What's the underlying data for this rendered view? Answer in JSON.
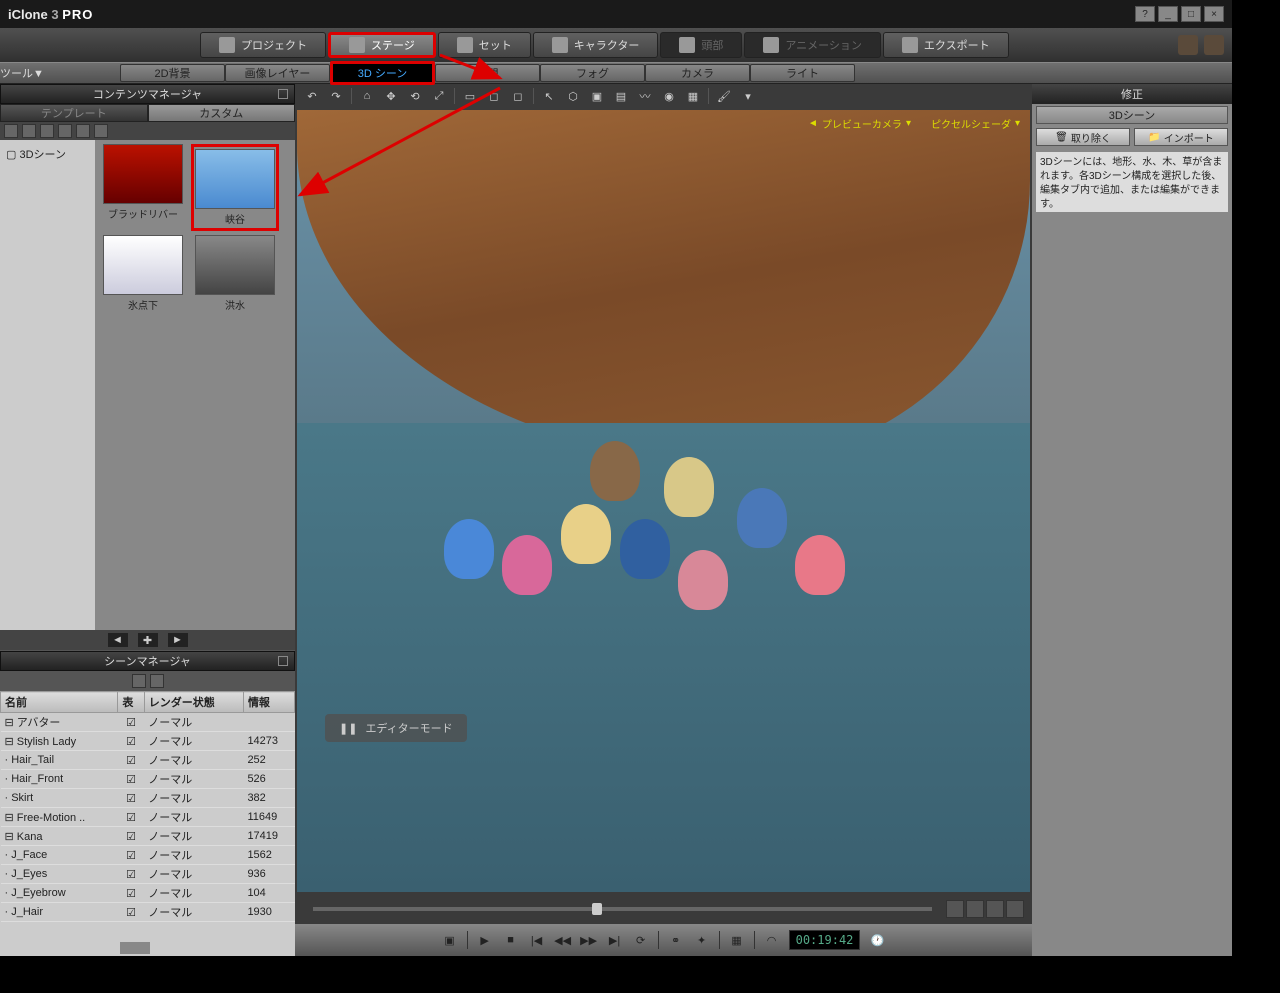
{
  "app": {
    "name": "iClone",
    "version": "3",
    "edition": "PRO"
  },
  "winButtons": [
    "?",
    "_",
    "□",
    "×"
  ],
  "mainTabs": [
    {
      "label": "プロジェクト"
    },
    {
      "label": "ステージ",
      "active": true,
      "highlighted": true
    },
    {
      "label": "セット"
    },
    {
      "label": "キャラクター"
    },
    {
      "label": "頭部",
      "dim": true
    },
    {
      "label": "アニメーション",
      "dim": true
    },
    {
      "label": "エクスポート"
    }
  ],
  "toolLabel": "ツール▼",
  "subTabs": [
    {
      "label": "2D背景"
    },
    {
      "label": "画像レイヤー"
    },
    {
      "label": "3D シーン",
      "active": true,
      "highlighted": true
    },
    {
      "label": "空間"
    },
    {
      "label": "フォグ"
    },
    {
      "label": "カメラ"
    },
    {
      "label": "ライト"
    }
  ],
  "contentManager": {
    "title": "コンテンツマネージャ",
    "tabs": [
      {
        "label": "テンプレート"
      },
      {
        "label": "カスタム",
        "active": true
      }
    ],
    "treeItem": "3Dシーン",
    "thumbs": [
      {
        "label": "ブラッドリバー",
        "bg": "linear-gradient(#bb1100,#660000)"
      },
      {
        "label": "峡谷",
        "bg": "linear-gradient(#88bde8,#4a8ad0)",
        "highlighted": true
      },
      {
        "label": "氷点下",
        "bg": "linear-gradient(#fff,#ccd)"
      },
      {
        "label": "洪水",
        "bg": "linear-gradient(#888,#444)"
      }
    ]
  },
  "sceneManager": {
    "title": "シーンマネージャ",
    "columns": [
      "名前",
      "表",
      "レンダー状態",
      "情報"
    ],
    "rows": [
      {
        "name": "アバター",
        "indent": 0,
        "expand": "⊟",
        "chk": true,
        "render": "ノーマル",
        "info": ""
      },
      {
        "name": "Stylish Lady",
        "indent": 1,
        "expand": "⊟",
        "chk": true,
        "render": "ノーマル",
        "info": "14273"
      },
      {
        "name": "Hair_Tail",
        "indent": 2,
        "expand": "·",
        "chk": true,
        "render": "ノーマル",
        "info": "252"
      },
      {
        "name": "Hair_Front",
        "indent": 2,
        "expand": "·",
        "chk": true,
        "render": "ノーマル",
        "info": "526"
      },
      {
        "name": "Skirt",
        "indent": 2,
        "expand": "·",
        "chk": true,
        "render": "ノーマル",
        "info": "382"
      },
      {
        "name": "Free-Motion ..",
        "indent": 1,
        "expand": "⊟",
        "chk": true,
        "render": "ノーマル",
        "info": "11649"
      },
      {
        "name": "Kana",
        "indent": 1,
        "expand": "⊟",
        "chk": true,
        "render": "ノーマル",
        "info": "17419"
      },
      {
        "name": "J_Face",
        "indent": 2,
        "expand": "·",
        "chk": true,
        "render": "ノーマル",
        "info": "1562"
      },
      {
        "name": "J_Eyes",
        "indent": 2,
        "expand": "·",
        "chk": true,
        "render": "ノーマル",
        "info": "936"
      },
      {
        "name": "J_Eyebrow",
        "indent": 2,
        "expand": "·",
        "chk": true,
        "render": "ノーマル",
        "info": "104"
      },
      {
        "name": "J_Hair",
        "indent": 2,
        "expand": "·",
        "chk": true,
        "render": "ノーマル",
        "info": "1930"
      }
    ]
  },
  "viewport": {
    "overlay": {
      "camera": "プレビューカメラ",
      "shader": "ピクセルシェーダ"
    },
    "editorMode": "エディターモード"
  },
  "playback": {
    "time": "00:19:42"
  },
  "rightPanel": {
    "title": "修正",
    "sub": "3Dシーン",
    "btnRemove": "取り除く",
    "btnImport": "インポート",
    "description": "3Dシーンには、地形、水、木、草が含まれます。各3Dシーン構成を選択した後、編集タブ内で追加、または編集ができます。"
  }
}
